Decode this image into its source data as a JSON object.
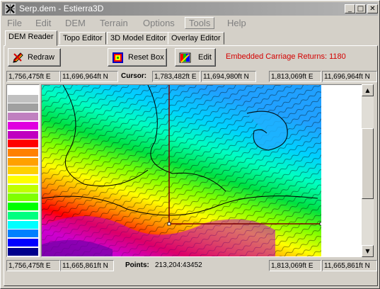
{
  "window": {
    "title": "Serp.dem - Estierra3D",
    "app_icon": "x-cross-icon"
  },
  "title_buttons": {
    "minimize": "_",
    "maximize": "□",
    "close": "✕"
  },
  "menu": [
    "File",
    "Edit",
    "DEM",
    "Terrain",
    "Options",
    "Tools",
    "Help"
  ],
  "tabs": [
    "DEM Reader",
    "Topo Editor",
    "3D Model Editor",
    "Overlay Editor"
  ],
  "toolbar": {
    "redraw_label": "Redraw",
    "reset_box_label": "Reset Box",
    "edit_label": "Edit",
    "status_text": "Embedded Carriage Returns: 1180"
  },
  "top_coords": {
    "west_x": "1,756,475ft E",
    "north_y": "11,696,964ft N",
    "cursor_label": "Cursor:",
    "cursor_x": "1,783,482ft E",
    "cursor_y": "11,694,980ft N",
    "east_x": "1,813,069ft E",
    "north_y2": "11,696,964ft N"
  },
  "bottom_coords": {
    "west_x": "1,756,475ft E",
    "south_y": "11,665,861ft N",
    "points_label": "Points:",
    "points_value": "213,204:43452",
    "east_x": "1,813,069ft E",
    "south_y2": "11,665,861ft N"
  },
  "legend_colors": [
    "#ffffff",
    "#c0c0c0",
    "#a0a0a0",
    "#c080c0",
    "#e000e0",
    "#c000c0",
    "#ff0000",
    "#ff8000",
    "#ffa000",
    "#ffd000",
    "#ffff00",
    "#c0ff00",
    "#80ff00",
    "#00ff00",
    "#00ff80",
    "#00ffff",
    "#0080ff",
    "#0000ff",
    "#00008c"
  ],
  "colors": {
    "accent_red": "#d40000",
    "title_grad_start": "#808080"
  }
}
